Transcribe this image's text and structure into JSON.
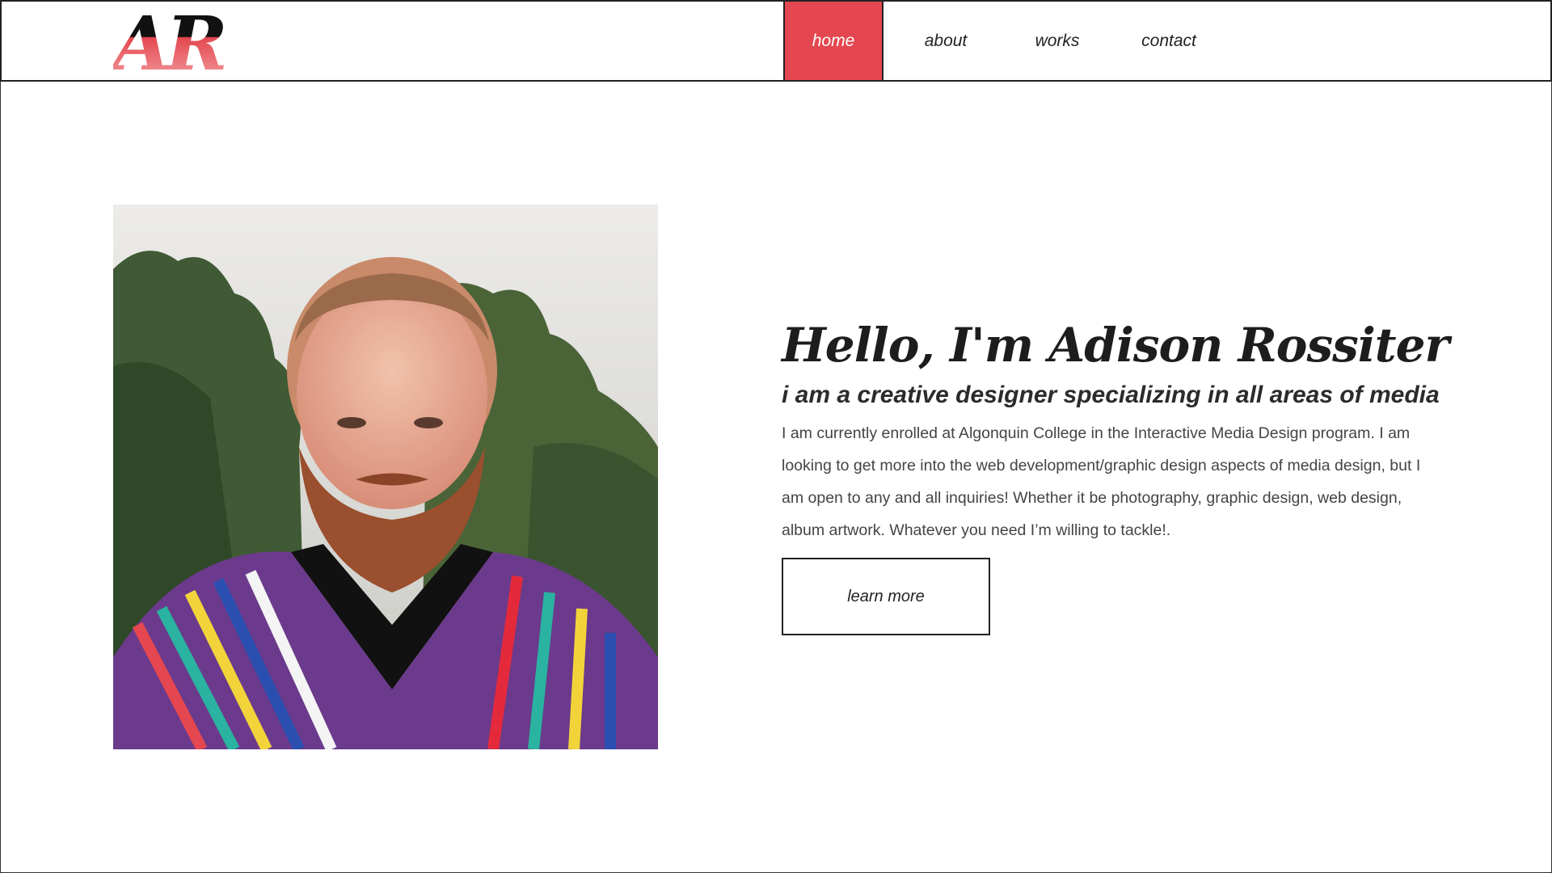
{
  "brand": {
    "logo_text": "AR",
    "accent_color": "#e4474f"
  },
  "nav": {
    "items": [
      {
        "label": "home",
        "active": true
      },
      {
        "label": "about",
        "active": false
      },
      {
        "label": "works",
        "active": false
      },
      {
        "label": "contact",
        "active": false
      }
    ]
  },
  "hero": {
    "title": "Hello, I'm Adison Rossiter",
    "subtitle": "i am a creative designer specializing in all areas of media",
    "body": "I am currently enrolled at Algonquin College in the Interactive Media Design program. I am looking to get more into the web development/graphic design aspects of media design, but I am open to any and all inquiries! Whether it be photography, graphic design, web design, album artwork. Whatever you need I’m willing to tackle!.",
    "button_label": "learn more"
  }
}
